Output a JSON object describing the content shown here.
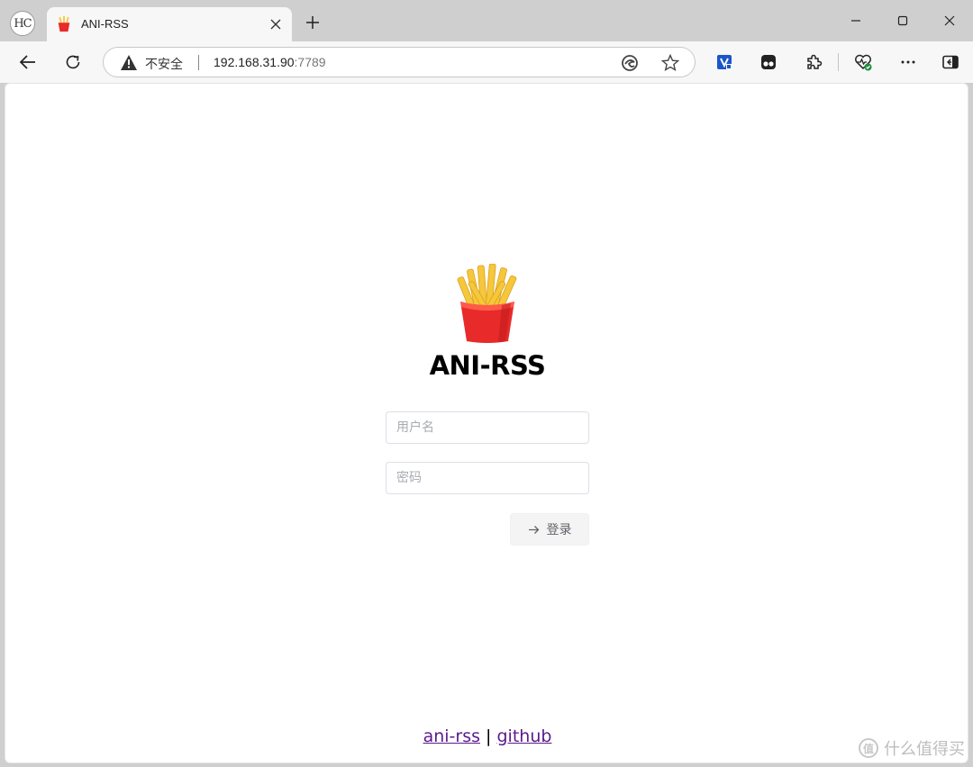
{
  "browser": {
    "profile_initials": "HC",
    "tab": {
      "title": "ANI-RSS",
      "favicon": "french-fries-icon"
    },
    "address": {
      "security_label": "不安全",
      "host": "192.168.31.90",
      "port": ":7789"
    }
  },
  "page": {
    "app_title": "ANI-RSS",
    "username": {
      "placeholder": "用户名",
      "value": ""
    },
    "password": {
      "placeholder": "密码",
      "value": ""
    },
    "login_label": "登录",
    "footer": {
      "link1": "ani-rss",
      "separator": "|",
      "link2": "github"
    }
  },
  "watermark": {
    "text": "什么值得买",
    "logo_text": "值"
  },
  "colors": {
    "link": "#5a1b8c",
    "fries_red": "#e82a2a",
    "fries_yellow": "#f6c73a"
  }
}
